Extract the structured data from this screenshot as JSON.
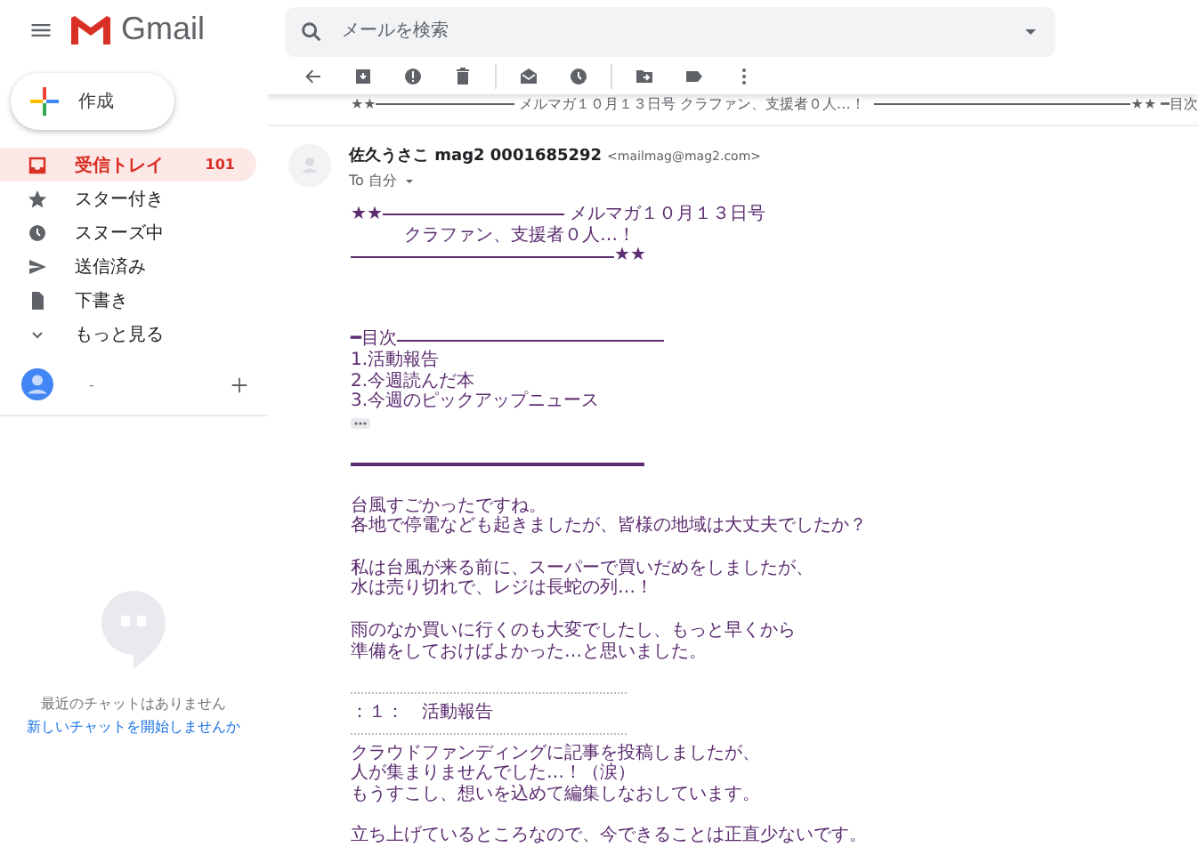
{
  "app": {
    "name": "Gmail"
  },
  "search": {
    "placeholder": "メールを検索"
  },
  "compose": {
    "label": "作成"
  },
  "sidebar": {
    "items": [
      {
        "label": "受信トレイ",
        "count": "101",
        "selected": true
      },
      {
        "label": "スター付き",
        "selected": false
      },
      {
        "label": "スヌーズ中",
        "selected": false
      },
      {
        "label": "送信済み",
        "selected": false
      },
      {
        "label": "下書き",
        "selected": false
      },
      {
        "label": "もっと見る",
        "selected": false
      }
    ]
  },
  "account": {
    "name": "-"
  },
  "chat": {
    "empty": "最近のチャットはありません",
    "link": "新しいチャットを開始しませんか"
  },
  "previous_message": {
    "lead": "★★",
    "subject": "メルマガ１０月１３日号 クラファン、支援者０人…！",
    "tail": "★★ ━目次"
  },
  "message": {
    "sender": "佐久うさこ mag2 0001685292",
    "email": "<mailmag@mag2.com>",
    "recipient": "To 自分",
    "body": [
      {
        "kind": "ruled",
        "lead": "★★",
        "text": "メルマガ１０月１３日号"
      },
      {
        "kind": "indent",
        "text": "クラファン、支援者０人…！"
      },
      {
        "kind": "ruled_end",
        "text": "★★"
      },
      {
        "kind": "blank"
      },
      {
        "kind": "blank"
      },
      {
        "kind": "blank"
      },
      {
        "kind": "ruled_head",
        "text": "━目次"
      },
      {
        "kind": "text",
        "text": "1.活動報告"
      },
      {
        "kind": "text",
        "text": "2.今週読んだ本"
      },
      {
        "kind": "text",
        "text": "3.今週のピックアップニュース"
      },
      {
        "kind": "trimmed"
      },
      {
        "kind": "blank"
      },
      {
        "kind": "rule"
      },
      {
        "kind": "blank"
      },
      {
        "kind": "text",
        "text": "台風すごかったですね。"
      },
      {
        "kind": "text",
        "text": "各地で停電なども起きましたが、皆様の地域は大丈夫でしたか？"
      },
      {
        "kind": "blank"
      },
      {
        "kind": "text",
        "text": "私は台風が来る前に、スーパーで買いだめをしましたが、"
      },
      {
        "kind": "text",
        "text": "水は売り切れで、レジは長蛇の列…！"
      },
      {
        "kind": "blank"
      },
      {
        "kind": "text",
        "text": "雨のなか買いに行くのも大変でしたし、もっと早くから"
      },
      {
        "kind": "text",
        "text": "準備をしておけばよかった…と思いました。"
      },
      {
        "kind": "blank"
      },
      {
        "kind": "dotted"
      },
      {
        "kind": "text",
        "text": "：１：　活動報告"
      },
      {
        "kind": "dotted"
      },
      {
        "kind": "text",
        "text": "クラウドファンディングに記事を投稿しましたが、"
      },
      {
        "kind": "text",
        "text": "人が集まりませんでした…！（涙）"
      },
      {
        "kind": "text",
        "text": "もうすこし、想いを込めて編集しなおしています。"
      },
      {
        "kind": "blank"
      },
      {
        "kind": "text",
        "text": "立ち上げているところなので、今できることは正直少ないです。"
      }
    ]
  }
}
